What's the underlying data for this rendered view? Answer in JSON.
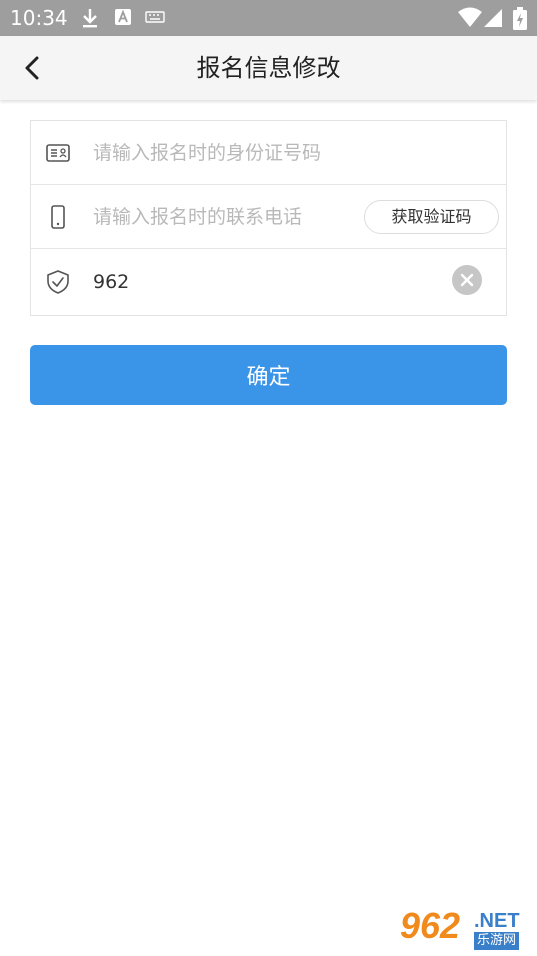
{
  "status_bar": {
    "time": "10:34",
    "icons": [
      "download-icon",
      "a-notification-icon",
      "keyboard-icon",
      "wifi-icon",
      "signal-icon",
      "battery-icon"
    ]
  },
  "header": {
    "title": "报名信息修改",
    "back_icon": "chevron-left-icon"
  },
  "form": {
    "id_field": {
      "icon": "id-card-icon",
      "placeholder": "请输入报名时的身份证号码",
      "value": ""
    },
    "phone_field": {
      "icon": "phone-icon",
      "placeholder": "请输入报名时的联系电话",
      "value": "",
      "code_button_label": "获取验证码"
    },
    "code_field": {
      "icon": "shield-check-icon",
      "value": "962",
      "clear_icon": "clear-circle-icon"
    }
  },
  "confirm_label": "确定",
  "watermark": {
    "number": "962",
    "net": ".NET",
    "name": "乐游网"
  },
  "colors": {
    "accent": "#3a94e7",
    "status_bar": "#9e9e9e",
    "app_bar": "#f5f5f5"
  }
}
